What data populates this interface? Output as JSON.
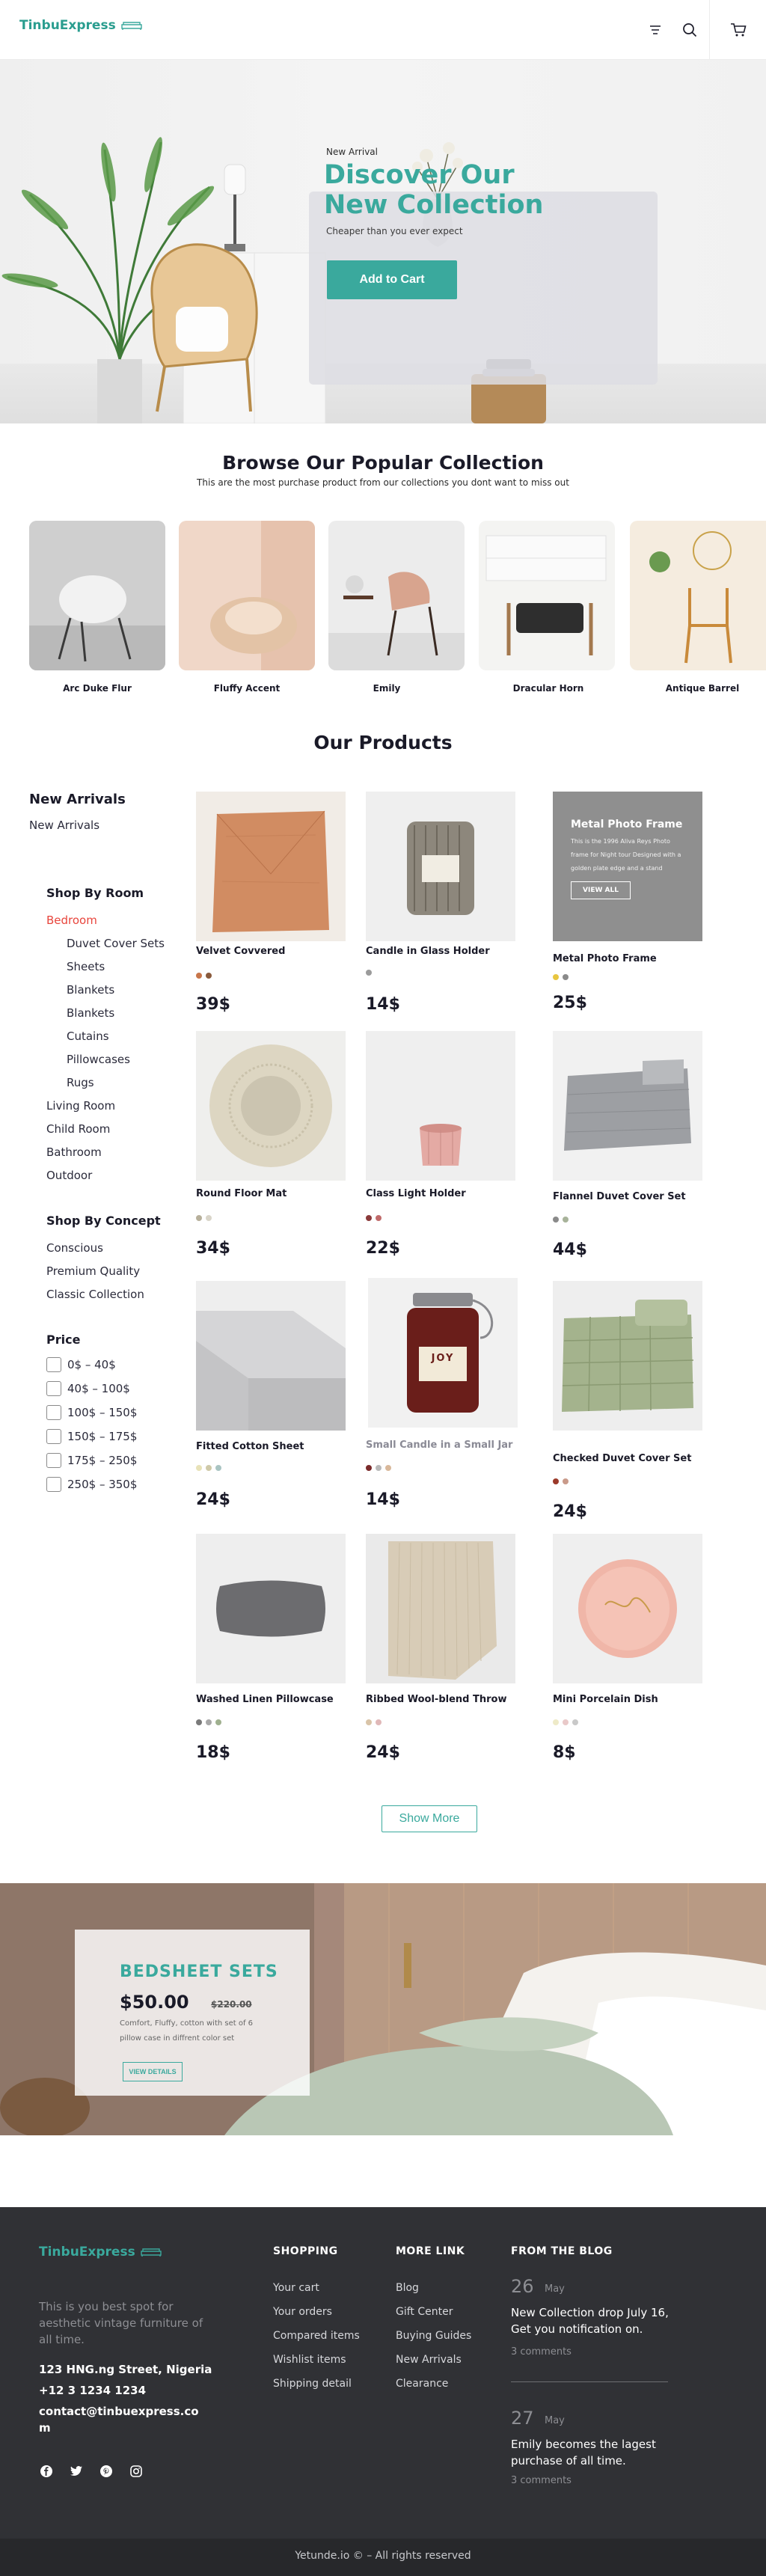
{
  "brand": {
    "name": "TinbuExpress",
    "accent": "#3aa99d",
    "sale_color": "#e8453c"
  },
  "header": {
    "icons": [
      "filter-icon",
      "search-icon",
      "cart-icon"
    ]
  },
  "hero": {
    "kicker": "New Arrival",
    "title": "Discover Our New Collection",
    "subtitle": "Cheaper than you ever expect",
    "cta": "Add to Cart"
  },
  "popular": {
    "title": "Browse Our Popular Collection",
    "subtitle": "This are the most purchase product from our collections you dont want to miss out",
    "items": [
      "Arc Duke Flur",
      "Fluffy Accent",
      "Emily",
      "Dracular Horn",
      "Antique Barrel"
    ]
  },
  "products_title": "Our Products",
  "sidebar": {
    "new_arrivals_heading": "New Arrivals",
    "new_arrivals_link": "New Arrivals",
    "room_heading": "Shop By Room",
    "rooms": [
      "Bedroom",
      "Duvet Cover Sets",
      "Sheets",
      "Blankets",
      "Blankets",
      "Cutains",
      "Pillowcases",
      "Rugs",
      "Living Room",
      "Child Room",
      "Bathroom",
      "Outdoor"
    ],
    "concept_heading": "Shop By Concept",
    "concepts": [
      "Conscious",
      "Premium Quality",
      "Classic Collection"
    ],
    "price_heading": "Price",
    "prices": [
      "0$ – 40$",
      "40$ – 100$",
      "100$ – 150$",
      "150$ – 175$",
      "175$ – 250$",
      "250$ – 350$"
    ]
  },
  "products": [
    {
      "name": "Velvet Covvered",
      "price": "39$",
      "colors": [
        "#c8764a",
        "#8a5a3c"
      ]
    },
    {
      "name": "Candle in Glass Holder",
      "price": "14$",
      "colors": [
        "#9b9b9b"
      ]
    },
    {
      "name": "Metal Photo Frame",
      "price": "25$",
      "colors": [
        "#e8c640",
        "#8a8a8a"
      ]
    },
    {
      "name": "Round Floor Mat",
      "price": "34$",
      "colors": [
        "#b7b09b",
        "#d9d5c9"
      ]
    },
    {
      "name": "Class Light Holder",
      "price": "22$",
      "colors": [
        "#8a3a3a",
        "#c06a6a"
      ]
    },
    {
      "name": "Flannel Duvet Cover Set",
      "price": "44$",
      "colors": [
        "#8a8a8a",
        "#a8b39a"
      ]
    },
    {
      "name": "Fitted Cotton Sheet",
      "price": "24$",
      "colors": [
        "#e8e2b8",
        "#cfc9a8",
        "#a9c4c2"
      ]
    },
    {
      "name": "Small Candle in a Small Jar",
      "price": "14$",
      "colors": [
        "#7a2a2a",
        "#b9b9b9",
        "#d9b89a"
      ]
    },
    {
      "name": "Checked Duvet Cover Set",
      "price": "24$",
      "colors": [
        "#9b3a2a",
        "#c99a8a"
      ]
    },
    {
      "name": "Washed Linen Pillowcase",
      "price": "18$",
      "colors": [
        "#7a7a7a",
        "#a8a8a8",
        "#9fb08f"
      ]
    },
    {
      "name": "Ribbed Wool-blend Throw",
      "price": "24$",
      "colors": [
        "#d9c4a8",
        "#e0b8b8"
      ]
    },
    {
      "name": "Mini Porcelain Dish",
      "price": "8$",
      "colors": [
        "#eeeac8",
        "#e9c9c9",
        "#c9c9c9"
      ]
    }
  ],
  "frame_overlay": {
    "title": "Metal Photo Frame",
    "desc": "This is the 1996 Aliva Reys Photo frame for Night tour Designed with a golden plate edge and a stand",
    "cta": "VIEW ALL"
  },
  "mug_text": {
    "jar_label": "JOY"
  },
  "show_more": "Show  More",
  "banner": {
    "title": "BEDSHEET SETS",
    "price": "$50.00",
    "old_price": "$220.00",
    "desc": "Comfort, Fluffy, cotton with set of 6 pillow case in diffrent color set",
    "cta": "VIEW DETAILS"
  },
  "footer": {
    "tagline": "This is you best spot for aesthetic vintage furniture of all time.",
    "address": "123 HNG.ng Street, Nigeria",
    "phone": "+12 3 1234 1234",
    "email": "contact@tinbuexpress.com",
    "social": [
      "facebook-icon",
      "twitter-icon",
      "pinterest-icon",
      "instagram-icon"
    ],
    "shopping_heading": "SHOPPING",
    "shopping_links": [
      "Your cart",
      "Your orders",
      "Compared items",
      "Wishlist items",
      "Shipping detail"
    ],
    "more_heading": "MORE LINK",
    "more_links": [
      "Blog",
      "Gift Center",
      "Buying Guides",
      "New Arrivals",
      "Clearance"
    ],
    "blog_heading": "FROM THE BLOG",
    "blog": [
      {
        "day": "26",
        "month": "May",
        "text": "New Collection drop July 16, Get you notification on.",
        "comments": "3 comments"
      },
      {
        "day": "27",
        "month": "May",
        "text": "Emily becomes the lagest purchase of all time.",
        "comments": "3 comments"
      }
    ],
    "copyright": "Yetunde.io  ©  – All rights reserved"
  }
}
